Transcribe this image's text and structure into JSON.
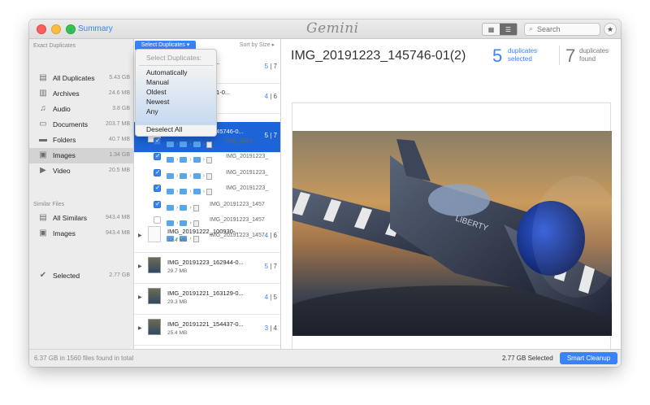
{
  "titlebar": {
    "back_label": "Summary",
    "logo": "Gemini",
    "search_placeholder": "Search"
  },
  "sidebar": {
    "exact_header": "Exact Duplicates",
    "exact_items": [
      {
        "label": "All Duplicates",
        "size": "5.43 GB",
        "icon": "stack-icon"
      },
      {
        "label": "Archives",
        "size": "24.6 MB",
        "icon": "archive-icon"
      },
      {
        "label": "Audio",
        "size": "3.8 GB",
        "icon": "music-icon"
      },
      {
        "label": "Documents",
        "size": "203.7 MB",
        "icon": "document-icon"
      },
      {
        "label": "Folders",
        "size": "40.7 MB",
        "icon": "folder-icon"
      },
      {
        "label": "Images",
        "size": "1.34 GB",
        "icon": "image-icon",
        "selected": true
      },
      {
        "label": "Video",
        "size": "20.5 MB",
        "icon": "video-icon"
      }
    ],
    "similar_header": "Similar Files",
    "similar_items": [
      {
        "label": "All Similars",
        "size": "943.4 MB",
        "icon": "stack-icon"
      },
      {
        "label": "Images",
        "size": "943.4 MB",
        "icon": "image-icon"
      }
    ],
    "selected_item": {
      "label": "Selected",
      "size": "2.77 GB",
      "icon": "checkmark-icon"
    }
  },
  "middle": {
    "select_button": "Select Duplicates ▾",
    "sort_label": "Sort by Size ▸",
    "groups_top": [
      {
        "name": "IMG_20191754-0...",
        "a": "5",
        "b": "7"
      },
      {
        "name": "IMG_20191443321-0...",
        "a": "4",
        "b": "6"
      },
      {
        "name": "IMG_20191223_145746-0...",
        "a": "5",
        "b": "7",
        "selected": true
      }
    ],
    "sub_rows": [
      {
        "checked": true,
        "file": "IMG_2019"
      },
      {
        "checked": true,
        "file": "IMG_20191223_"
      },
      {
        "checked": true,
        "file": "IMG_20191223_"
      },
      {
        "checked": true,
        "file": "IMG_20191223_"
      },
      {
        "checked": true,
        "file": "IMG_20191223_1457"
      },
      {
        "checked": false,
        "file": "IMG_20191223_1457"
      },
      {
        "checked": false,
        "file": "IMG_20191223_1457"
      }
    ],
    "groups_bottom": [
      {
        "name": "IMG_20191222_100930-...",
        "size": "32.4 MB",
        "a": "4",
        "b": "6"
      },
      {
        "name": "IMG_20191223_162944-0...",
        "size": "29.7 MB",
        "a": "5",
        "b": "7"
      },
      {
        "name": "IMG_20191221_163129-0...",
        "size": "29.3 MB",
        "a": "4",
        "b": "5"
      },
      {
        "name": "IMG_20191221_154437-0...",
        "size": "25.4 MB",
        "a": "3",
        "b": "4"
      },
      {
        "name": "IMG_20191223_144101-B...",
        "size": "",
        "a": "",
        "b": ""
      }
    ]
  },
  "dropdown": {
    "header": "Select Duplicates:",
    "options": [
      "Automatically",
      "Manual",
      "Oldest",
      "Newest",
      "Any"
    ],
    "deselect": "Deselect All"
  },
  "detail": {
    "title": "IMG_20191223_145746-01(2)",
    "selected_count": "5",
    "selected_label_1": "duplicates",
    "selected_label_2": "selected",
    "found_count": "7",
    "found_label_1": "duplicates",
    "found_label_2": "found"
  },
  "status": {
    "left": "6.37 GB in 1560 files found in total",
    "selected": "2.77 GB Selected",
    "cleanup": "Smart Cleanup"
  },
  "colors": {
    "accent": "#3a82f7",
    "selection": "#1d64d8"
  }
}
